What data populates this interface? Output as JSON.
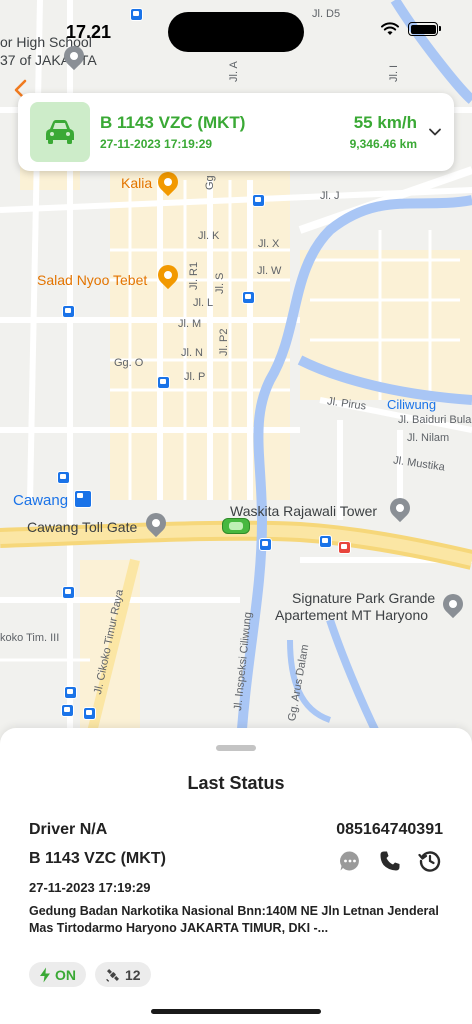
{
  "status_bar": {
    "time": "17.21"
  },
  "map": {
    "labels": {
      "school_line1": "or High School",
      "school_line2": "37 of JAKARTA",
      "kalia": "Kalia",
      "salad": "Salad Nyoo Tebet",
      "cawang": "Cawang",
      "cawang_toll": "Cawang Toll Gate",
      "waskita": "Waskita Rajawali Tower",
      "signature_line1": "Signature Park Grande",
      "signature_line2": "Apartement MT Haryono",
      "ciliwung": "Ciliwung",
      "jl_d5": "Jl. D5",
      "jl_j": "Jl. J",
      "jl_k": "Jl. K",
      "jl_x": "Jl. X",
      "jl_w": "Jl. W",
      "jl_r1": "Jl. R1",
      "jl_s": "Jl. S",
      "jl_l": "Jl. L",
      "jl_m": "Jl. M",
      "jl_p2": "Jl. P2",
      "jl_n": "Jl. N",
      "gg_o": "Gg. O",
      "jl_p": "Jl. P",
      "jl_pirus": "Jl. Pirus",
      "jl_baiduri": "Jl. Baiduri Bula",
      "jl_nilam": "Jl. Nilam",
      "jl_mustika": "Jl. Mustika",
      "jl_cikoko": "Jl. Cikoko Timur Raya",
      "cikoko_tim": "koko Tim. III",
      "jl_inspeksi": "Jl. Inspeksi Ciliwung",
      "gg_arus": "Gg. Arus Dalam",
      "jl_i": "Jl. I",
      "jl_a": "Jl. A",
      "jl_g": "Gg"
    }
  },
  "vehicle_card": {
    "plate": "B 1143 VZC (MKT)",
    "datetime": "27-11-2023 17:19:29",
    "speed": "55 km/h",
    "odometer": "9,346.46 km"
  },
  "sheet": {
    "title": "Last Status",
    "driver": "Driver N/A",
    "phone": "085164740391",
    "plate": "B 1143 VZC (MKT)",
    "datetime": "27-11-2023 17:19:29",
    "address": "Gedung Badan Narkotika Nasional Bnn:140M NE Jln Letnan Jenderal Mas Tirtodarmo Haryono JAKARTA TIMUR, DKI -...",
    "ignition_label": "ON",
    "satellites": "12"
  },
  "colors": {
    "accent_green": "#3aa935",
    "card_icon_bg": "#cdecc9",
    "back_arrow": "#f07a1f"
  }
}
